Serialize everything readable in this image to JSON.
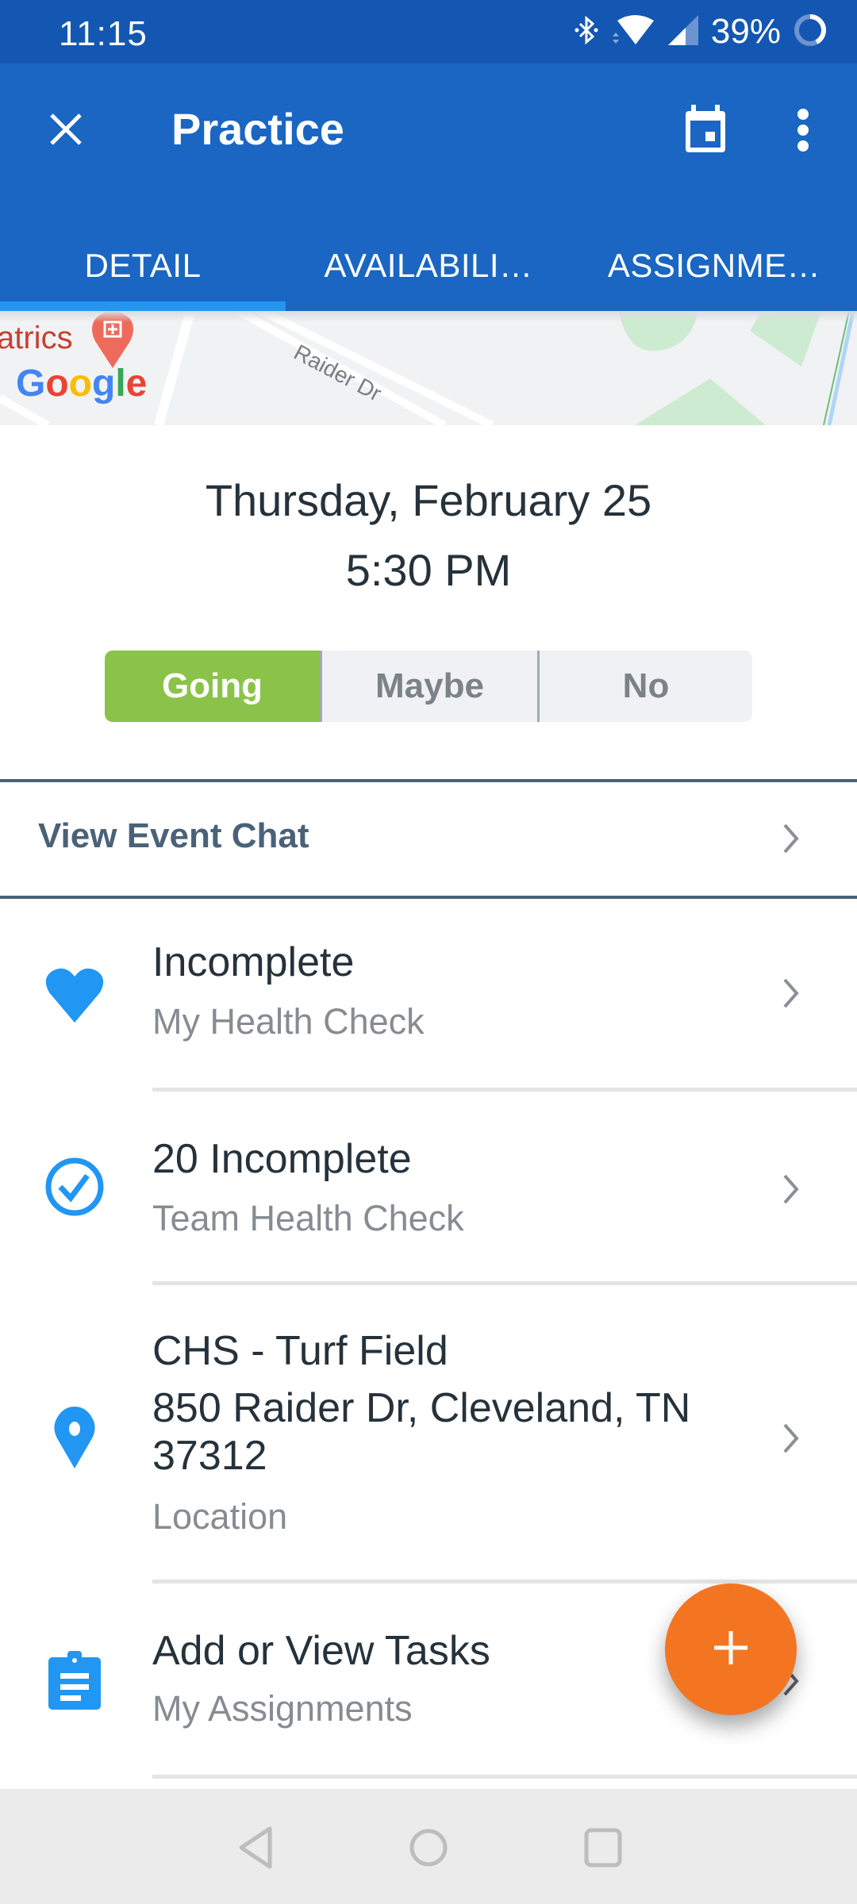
{
  "status_bar": {
    "time": "11:15",
    "battery_percent": "39%",
    "icons": [
      "bluetooth-icon",
      "wifi-icon",
      "cell-signal-icon",
      "battery-ring-icon"
    ]
  },
  "app_bar": {
    "title": "Practice",
    "close_icon": "close-icon",
    "calendar_icon": "calendar-icon",
    "more_icon": "more-vert-icon",
    "tabs": [
      {
        "label": "DETAIL",
        "active": true
      },
      {
        "label": "AVAILABILI…",
        "active": false
      },
      {
        "label": "ASSIGNME…",
        "active": false
      }
    ]
  },
  "map": {
    "poi_label": "atrics",
    "street_label": "Raider Dr",
    "logo": "Google"
  },
  "event": {
    "date": "Thursday, February 25",
    "time": "5:30 PM"
  },
  "rsvp": {
    "options": [
      {
        "label": "Going",
        "selected": true
      },
      {
        "label": "Maybe",
        "selected": false
      },
      {
        "label": "No",
        "selected": false
      }
    ],
    "selected_color": "#8bc34a"
  },
  "chat": {
    "label": "View Event Chat"
  },
  "rows": [
    {
      "icon": "heart-icon",
      "title": "Incomplete",
      "subtitle": "My Health Check"
    },
    {
      "icon": "check-circle-icon",
      "title": "20 Incomplete",
      "subtitle": "Team Health Check"
    },
    {
      "icon": "location-pin-icon",
      "title": "CHS - Turf Field",
      "address_line1": "850 Raider Dr, Cleveland, TN",
      "address_line2": "37312",
      "subtitle": "Location"
    },
    {
      "icon": "clipboard-icon",
      "title": "Add or View Tasks",
      "subtitle": "My Assignments"
    }
  ],
  "fab": {
    "icon": "plus-icon",
    "color": "#f47521"
  },
  "colors": {
    "status_bar": "#1457b2",
    "app_bar": "#1a66c2",
    "tab_indicator": "#2196f3",
    "icon_blue": "#2196f3",
    "chat_text": "#4a6278"
  },
  "nav_bar": {
    "buttons": [
      "back-icon",
      "home-icon",
      "recents-icon"
    ]
  }
}
